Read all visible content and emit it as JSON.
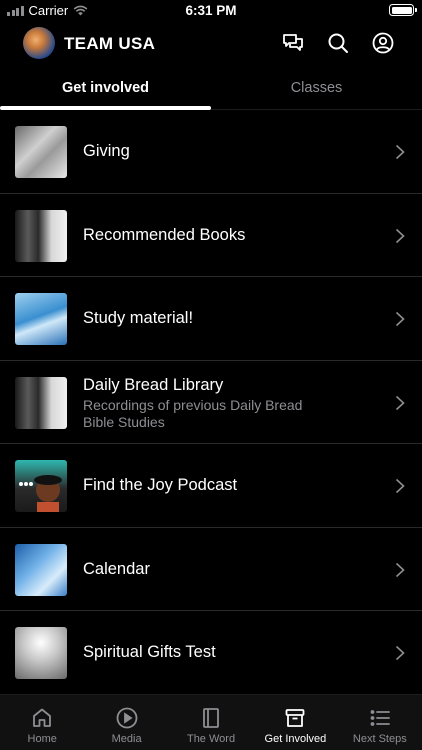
{
  "status_bar": {
    "carrier": "Carrier",
    "time": "6:31 PM"
  },
  "header": {
    "title": "TEAM USA",
    "icons": [
      "chat-icon",
      "search-icon",
      "account-icon"
    ]
  },
  "tabs": [
    {
      "label": "Get involved",
      "active": true
    },
    {
      "label": "Classes",
      "active": false
    }
  ],
  "items": [
    {
      "title": "Giving",
      "subtitle": ""
    },
    {
      "title": "Recommended Books",
      "subtitle": ""
    },
    {
      "title": "Study material!",
      "subtitle": ""
    },
    {
      "title": "Daily Bread Library",
      "subtitle": "Recordings of previous Daily Bread Bible Studies"
    },
    {
      "title": "Find the Joy Podcast",
      "subtitle": ""
    },
    {
      "title": "Calendar",
      "subtitle": ""
    },
    {
      "title": "Spiritual Gifts Test",
      "subtitle": ""
    }
  ],
  "bottom_nav": [
    {
      "label": "Home",
      "icon": "home-icon",
      "active": false
    },
    {
      "label": "Media",
      "icon": "play-icon",
      "active": false
    },
    {
      "label": "The Word",
      "icon": "book-icon",
      "active": false
    },
    {
      "label": "Get Involved",
      "icon": "archive-icon",
      "active": true
    },
    {
      "label": "Next Steps",
      "icon": "list-icon",
      "active": false
    }
  ],
  "colors": {
    "background": "#000000",
    "text": "#ffffff",
    "muted": "#8e8e93",
    "divider": "#2a2a2c"
  }
}
